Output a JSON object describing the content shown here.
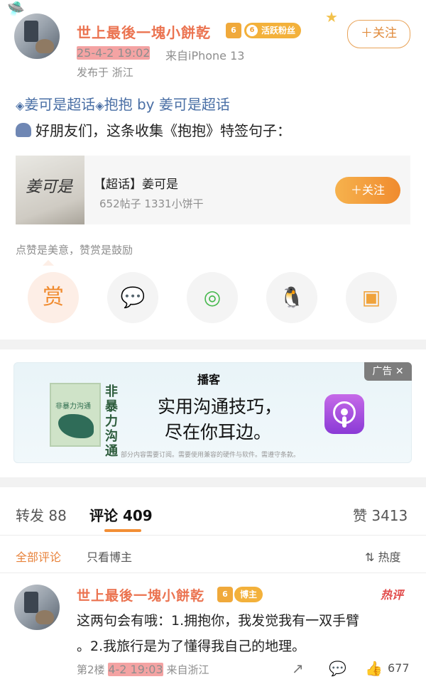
{
  "post": {
    "author": {
      "name": "世上最後一塊小餅乾",
      "vip_level": "6",
      "fan_badge_level": "6",
      "fan_badge_label": "活跃粉丝",
      "follow_label": "关注"
    },
    "time": "25-4-2 19:02",
    "source": "来自iPhone 13",
    "published_in": "发布于 浙江",
    "topic_1": "姜可是超话",
    "topic_2": "抱抱",
    "topic_by": "by",
    "topic_3": "姜可是超话",
    "body": "好朋友们，这条收集《抱抱》特签句子："
  },
  "supertopic_card": {
    "title": "【超话】姜可是",
    "posts": "652帖子",
    "fans": "1331小饼干",
    "follow_label": "关注"
  },
  "reward": {
    "hint": "点赞是美意，赞赏是鼓励",
    "reward_label": "赏"
  },
  "ad": {
    "brand": "播客",
    "line1": "实用沟通技巧，",
    "line2": "尽在你耳边。",
    "book_vertical": "非暴力沟通",
    "book_title": "非暴力沟通",
    "fine_print": "部分内容需要订阅。需要使用兼容的硬件与软件。需遵守条款。",
    "tag": "广告"
  },
  "tabs": {
    "repost_label": "转发",
    "repost_count": "88",
    "comment_label": "评论",
    "comment_count": "409",
    "like_label": "赞",
    "like_count": "3413"
  },
  "comment_filter": {
    "all": "全部评论",
    "owner_only": "只看博主",
    "sort": "热度"
  },
  "comment": {
    "author": "世上最後一塊小餅乾",
    "vip_level": "6",
    "role_badge": "博主",
    "hot_tag": "热评",
    "text_line1": "这两句会有哦：1.拥抱你，我发觉我有一双手臂",
    "text_line2": "。2.我旅行是为了懂得我自己的地理。",
    "floor": "第2楼",
    "time": "4-2 19:03",
    "source": "来自浙江",
    "likes": "677"
  },
  "colors": {
    "accent": "#eb7350",
    "link": "#4a6fa5",
    "follow": "#f08b2f",
    "highlight": "#f4a3a3"
  }
}
